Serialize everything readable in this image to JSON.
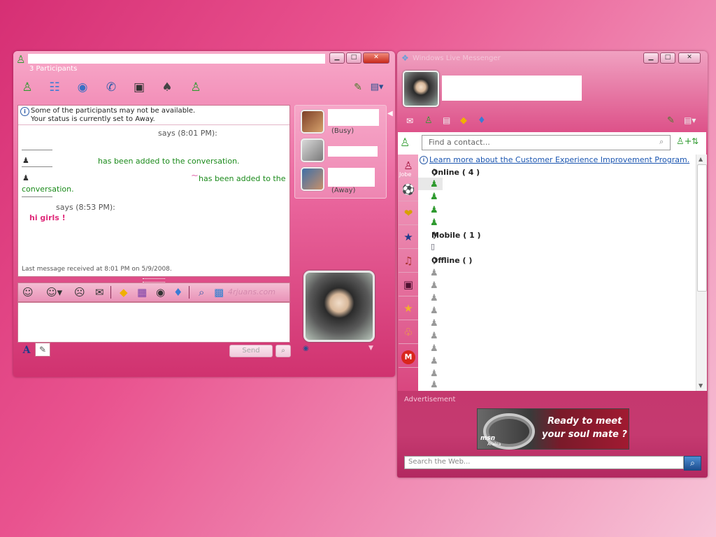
{
  "chat": {
    "participants_label": "3 Participants",
    "window_buttons": {
      "minimize": "▁",
      "maximize": "□",
      "close": "✕"
    },
    "toolbar_icons": [
      "invite-contact-icon",
      "share-files-icon",
      "webcam-icon",
      "call-icon",
      "video-icon",
      "games-icon",
      "block-icon"
    ],
    "notice_line1": "Some of the participants may not be available.",
    "notice_line2": "Your status is currently set to Away.",
    "messages": {
      "says_1": "says (8:01 PM):",
      "added_1": "has been added to the conversation.",
      "added_2_tail": "has been added to the",
      "added_2_wrap": "conversation.",
      "tilde": "~",
      "says_2": "says (8:53 PM):",
      "message_text": "hi girls !"
    },
    "last_message": "Last message received at 8:01 PM on 5/9/2008.",
    "participants": [
      {
        "status": "(Busy)"
      },
      {
        "status": ""
      },
      {
        "status": "(Away)"
      }
    ],
    "send_label": "Send",
    "watermark": "4rjuans.com",
    "font_button": "A"
  },
  "messenger": {
    "title": "Windows Live Messenger",
    "window_buttons": {
      "minimize": "▁",
      "maximize": "□",
      "close": "✕"
    },
    "search_placeholder": "Find a contact...",
    "info_link": "Learn more about the Customer Experience Improvement Program.",
    "groups": {
      "online": "Online ( 4 )",
      "mobile": "Mobile ( 1 )",
      "offline": "Offline (      )"
    },
    "side_tab_label": "Jobe",
    "advertisement_label": "Advertisement",
    "ad_line1": "Ready to meet",
    "ad_line2": "your soul mate ?",
    "ad_brand": "msn",
    "ad_brand_sub": "Arabia",
    "web_search_placeholder": "Search the Web..."
  }
}
